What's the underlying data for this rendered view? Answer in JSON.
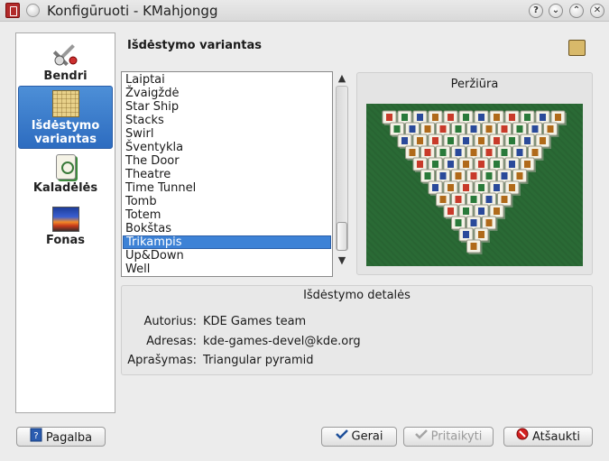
{
  "window": {
    "title": "Konfigūruoti - KMahjongg",
    "controls": [
      "?",
      "⌄",
      "⌃",
      "✕"
    ]
  },
  "sidebar": {
    "items": [
      {
        "label": "Bendri",
        "icon": "tools-icon",
        "selected": false
      },
      {
        "label": "Išdėstymo variantas",
        "icon": "layout-icon",
        "selected": true
      },
      {
        "label": "Kaladėlės",
        "icon": "tileset-icon",
        "selected": false
      },
      {
        "label": "Fonas",
        "icon": "background-icon",
        "selected": false
      }
    ]
  },
  "page": {
    "title": "Išdėstymo variantas"
  },
  "layouts": {
    "items": [
      "Laiptai",
      "Žvaigždė",
      "Star Ship",
      "Stacks",
      "Swirl",
      "Šventykla",
      "The Door",
      "Theatre",
      "Time Tunnel",
      "Tomb",
      "Totem",
      "Bokštas",
      "Trikampis",
      "Up&Down",
      "Well"
    ],
    "selected": "Trikampis"
  },
  "preview": {
    "label": "Peržiūra"
  },
  "details": {
    "title": "Išdėstymo detalės",
    "author_label": "Autorius:",
    "author": "KDE Games team",
    "address_label": "Adresas:",
    "address": "kde-games-devel@kde.org",
    "description_label": "Aprašymas:",
    "description": "Triangular pyramid"
  },
  "buttons": {
    "help": "Pagalba",
    "ok": "Gerai",
    "apply": "Pritaikyti",
    "cancel": "Atšaukti"
  },
  "colors": {
    "accent": "#3d82d6",
    "preview_bg": "#2a6a35"
  }
}
